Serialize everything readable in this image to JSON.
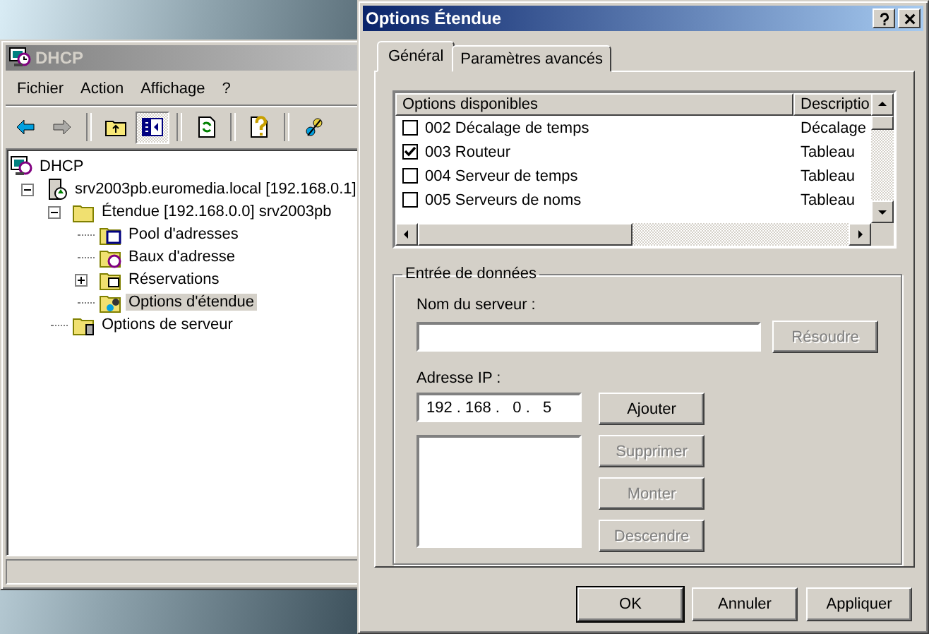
{
  "dhcp_window": {
    "title": "DHCP",
    "active": false,
    "menu": [
      "Fichier",
      "Action",
      "Affichage",
      "?"
    ],
    "toolbar": [
      {
        "kind": "back",
        "disabled": false,
        "pressed": false
      },
      {
        "kind": "forward",
        "disabled": true,
        "pressed": false
      },
      {
        "kind": "sep"
      },
      {
        "kind": "up",
        "disabled": false,
        "pressed": false
      },
      {
        "kind": "pane",
        "disabled": false,
        "pressed": true
      },
      {
        "kind": "sep"
      },
      {
        "kind": "refresh",
        "disabled": false,
        "pressed": false
      },
      {
        "kind": "sep"
      },
      {
        "kind": "help",
        "disabled": false,
        "pressed": false
      },
      {
        "kind": "sep"
      },
      {
        "kind": "options",
        "disabled": false,
        "pressed": false
      }
    ],
    "tree": [
      {
        "label": "DHCP",
        "kind": "dhcp",
        "selected": false,
        "children": [
          {
            "label": "srv2003pb.euromedia.local [192.168.0.1]",
            "kind": "server",
            "selected": false,
            "expanded": true,
            "children": [
              {
                "label": "Étendue [192.168.0.0] srv2003pb",
                "kind": "folder",
                "selected": false,
                "expanded": true,
                "children": [
                  {
                    "label": "Pool d'adresses",
                    "kind": "pool",
                    "selected": false
                  },
                  {
                    "label": "Baux d'adresse",
                    "kind": "leases",
                    "selected": false
                  },
                  {
                    "label": "Réservations",
                    "kind": "reservations",
                    "selected": false,
                    "expanded": false
                  },
                  {
                    "label": "Options d'étendue",
                    "kind": "options",
                    "selected": true
                  }
                ]
              },
              {
                "label": "Options de serveur",
                "kind": "serveroptions",
                "selected": false
              }
            ]
          }
        ]
      }
    ]
  },
  "dialog": {
    "title": "Options Étendue",
    "active": true,
    "tabs": [
      {
        "label": "Général",
        "selected": true
      },
      {
        "label": "Paramètres avancés",
        "selected": false
      }
    ],
    "options_list": {
      "columns": [
        "Options disponibles",
        "Descriptio"
      ],
      "rows": [
        {
          "name": "002 Décalage de temps",
          "description": "Décalage",
          "checked": false
        },
        {
          "name": "003 Routeur",
          "description": "Tableau",
          "checked": true
        },
        {
          "name": "004 Serveur de temps",
          "description": "Tableau",
          "checked": false
        },
        {
          "name": "005 Serveurs de noms",
          "description": "Tableau",
          "checked": false
        }
      ]
    },
    "data_entry": {
      "title": "Entrée de données",
      "server_label": "Nom du serveur :",
      "resolve_button": {
        "label": "Résoudre",
        "disabled": true
      },
      "ip_label": "Adresse IP :",
      "ip_value": "192 . 168 .   0 .   5",
      "buttons": [
        {
          "label": "Ajouter",
          "disabled": false
        },
        {
          "label": "Supprimer",
          "disabled": true
        },
        {
          "label": "Monter",
          "disabled": true
        },
        {
          "label": "Descendre",
          "disabled": true
        }
      ]
    },
    "buttons": [
      {
        "label": "OK",
        "default": true
      },
      {
        "label": "Annuler",
        "default": false
      },
      {
        "label": "Appliquer",
        "default": false
      }
    ]
  }
}
